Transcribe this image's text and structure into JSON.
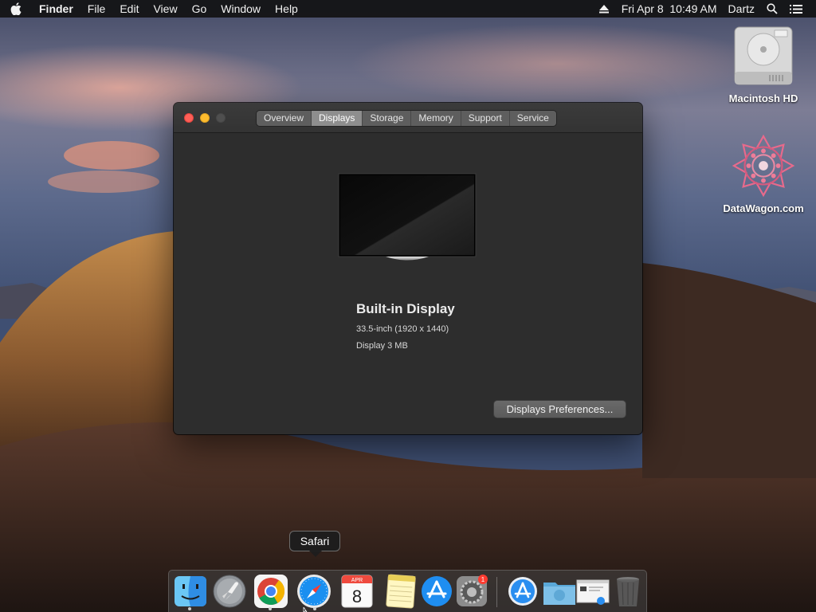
{
  "menubar": {
    "apple_icon": "apple-icon",
    "app_name": "Finder",
    "items": [
      "File",
      "Edit",
      "View",
      "Go",
      "Window",
      "Help"
    ],
    "clock": "Fri Apr 8  10:49 AM",
    "user": "Dartz",
    "status_icons": [
      "eject-icon",
      "search-icon",
      "list-icon"
    ]
  },
  "desktop": {
    "icons": [
      {
        "label": "Macintosh HD",
        "icon": "hard-drive-icon"
      },
      {
        "label": "DataWagon.com",
        "icon": "mandala-icon"
      }
    ]
  },
  "window": {
    "tabs": [
      {
        "label": "Overview",
        "active": false
      },
      {
        "label": "Displays",
        "active": true
      },
      {
        "label": "Storage",
        "active": false
      },
      {
        "label": "Memory",
        "active": false
      },
      {
        "label": "Support",
        "active": false
      },
      {
        "label": "Service",
        "active": false
      }
    ],
    "display": {
      "name": "Built-in Display",
      "size": "33.5-inch (1920 x 1440)",
      "memory": "Display 3 MB"
    },
    "prefs_button": "Displays Preferences..."
  },
  "tooltip": "Safari",
  "dock": {
    "items": [
      {
        "name": "Finder",
        "icon": "finder-icon",
        "running": true
      },
      {
        "name": "Launchpad",
        "icon": "launchpad-icon",
        "running": false
      },
      {
        "name": "Google Chrome",
        "icon": "chrome-icon",
        "running": true
      },
      {
        "name": "Safari",
        "icon": "safari-icon",
        "running": true
      },
      {
        "name": "Calendar",
        "icon": "calendar-icon",
        "running": false,
        "month": "APR",
        "day": "8"
      },
      {
        "name": "Notes",
        "icon": "notes-icon",
        "running": false
      },
      {
        "name": "App Store",
        "icon": "app-store-icon",
        "running": false
      },
      {
        "name": "System Preferences",
        "icon": "system-preferences-icon",
        "running": false,
        "badge": "1"
      },
      {
        "name": "Applications",
        "icon": "applications-folder-icon",
        "running": false
      },
      {
        "name": "Downloads",
        "icon": "downloads-folder-icon",
        "running": false
      },
      {
        "name": "Screenshot",
        "icon": "screenshot-icon",
        "running": false
      },
      {
        "name": "Trash",
        "icon": "trash-icon",
        "running": false
      }
    ]
  },
  "colors": {
    "close": "#ff5f57",
    "minimize": "#febc2e",
    "window_bg": "#2d2d2d",
    "active_tab": "#8e8e8e"
  }
}
